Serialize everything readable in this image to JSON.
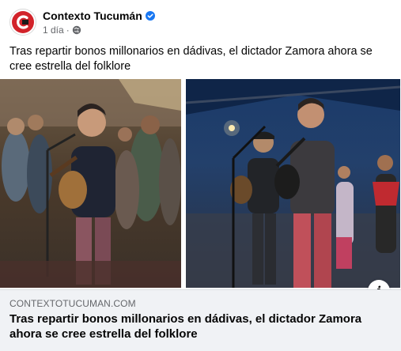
{
  "post": {
    "page_name": "Contexto Tucumán",
    "verified_icon": "verified-badge-icon",
    "time": "1 día",
    "separator": "·",
    "audience_icon": "globe-icon",
    "text": "Tras repartir bonos millonarios en dádivas, el dictador Zamora ahora se cree estrella del folklore"
  },
  "media": {
    "left_photo": "photo-man-singing-with-guitar-left",
    "right_photo": "photo-man-singing-with-guitar-right",
    "info_icon": "i"
  },
  "link_preview": {
    "domain": "CONTEXTOTUCUMAN.COM",
    "title": "Tras repartir bonos millonarios en dádivas, el dictador Zamora ahora se cree estrella del folklore"
  },
  "colors": {
    "brand_red": "#d2232a",
    "verified_blue": "#1877f2",
    "secondary_text": "#65676b",
    "link_bg": "#f0f2f5"
  }
}
